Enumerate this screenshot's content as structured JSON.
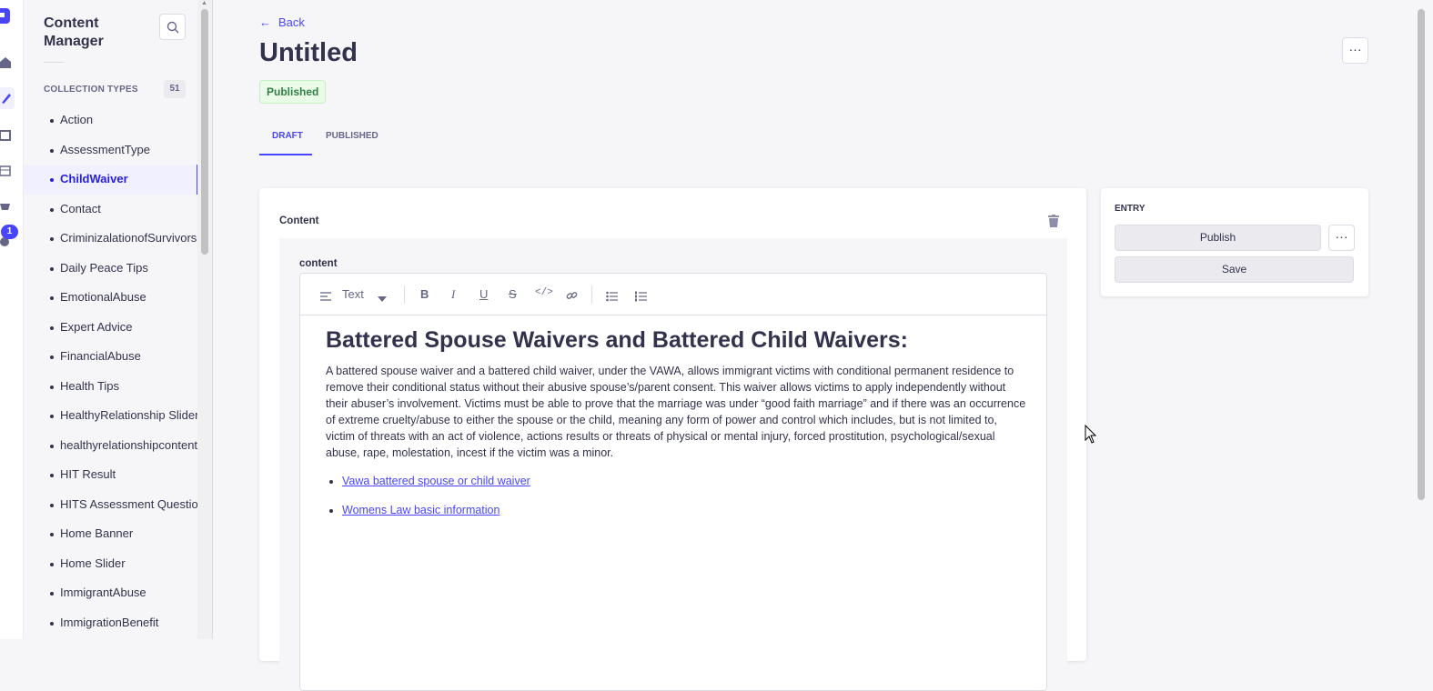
{
  "rail": {
    "notification_count": "1"
  },
  "sidebar": {
    "title": "Content Manager",
    "section_label": "COLLECTION TYPES",
    "section_count": "51",
    "items": [
      {
        "label": "Action"
      },
      {
        "label": "AssessmentType"
      },
      {
        "label": "ChildWaiver"
      },
      {
        "label": "Contact"
      },
      {
        "label": "CriminizalationofSurvivors"
      },
      {
        "label": "Daily Peace Tips"
      },
      {
        "label": "EmotionalAbuse"
      },
      {
        "label": "Expert Advice"
      },
      {
        "label": "FinancialAbuse"
      },
      {
        "label": "Health Tips"
      },
      {
        "label": "HealthyRelationship Slider"
      },
      {
        "label": "healthyrelationshipcontent"
      },
      {
        "label": "HIT Result"
      },
      {
        "label": "HITS Assessment Question"
      },
      {
        "label": "Home Banner"
      },
      {
        "label": "Home Slider"
      },
      {
        "label": "ImmigrantAbuse"
      },
      {
        "label": "ImmigrationBenefit"
      }
    ],
    "active_item": "ChildWaiver"
  },
  "header": {
    "back_label": "Back",
    "title": "Untitled",
    "status_badge": "Published",
    "more_label": "···"
  },
  "tabs": [
    {
      "label": "DRAFT",
      "selected": true
    },
    {
      "label": "PUBLISHED",
      "selected": false
    }
  ],
  "content_card": {
    "label": "Content",
    "field_label": "content",
    "toolbar": {
      "block_type": "Text"
    },
    "heading": "Battered Spouse Waivers and Battered Child Waivers:",
    "paragraph": "A battered spouse waiver and a battered child waiver, under the VAWA, allows immigrant  victims with conditional permanent residence to remove their conditional status without their  abusive spouse’s/parent consent. This waiver allows victims to apply independently without their  abuser’s involvement. Victims must be able to prove that the marriage was under “good faith  marriage” and if there was an occurrence of extreme cruelty/abuse to either the spouse or the  child, meaning any form of power and control which includes, but is not limited to, victim of  threats with an act of violence, actions results or threats of physical or mental injury, forced  prostitution, psychological/sexual abuse, rape, molestation, incest if the victim was a minor.",
    "links": [
      {
        "label": "Vawa battered spouse or child waiver"
      },
      {
        "label": "Womens Law basic information"
      }
    ]
  },
  "entry_panel": {
    "title": "ENTRY",
    "publish_label": "Publish",
    "more_label": "···",
    "save_label": "Save"
  }
}
